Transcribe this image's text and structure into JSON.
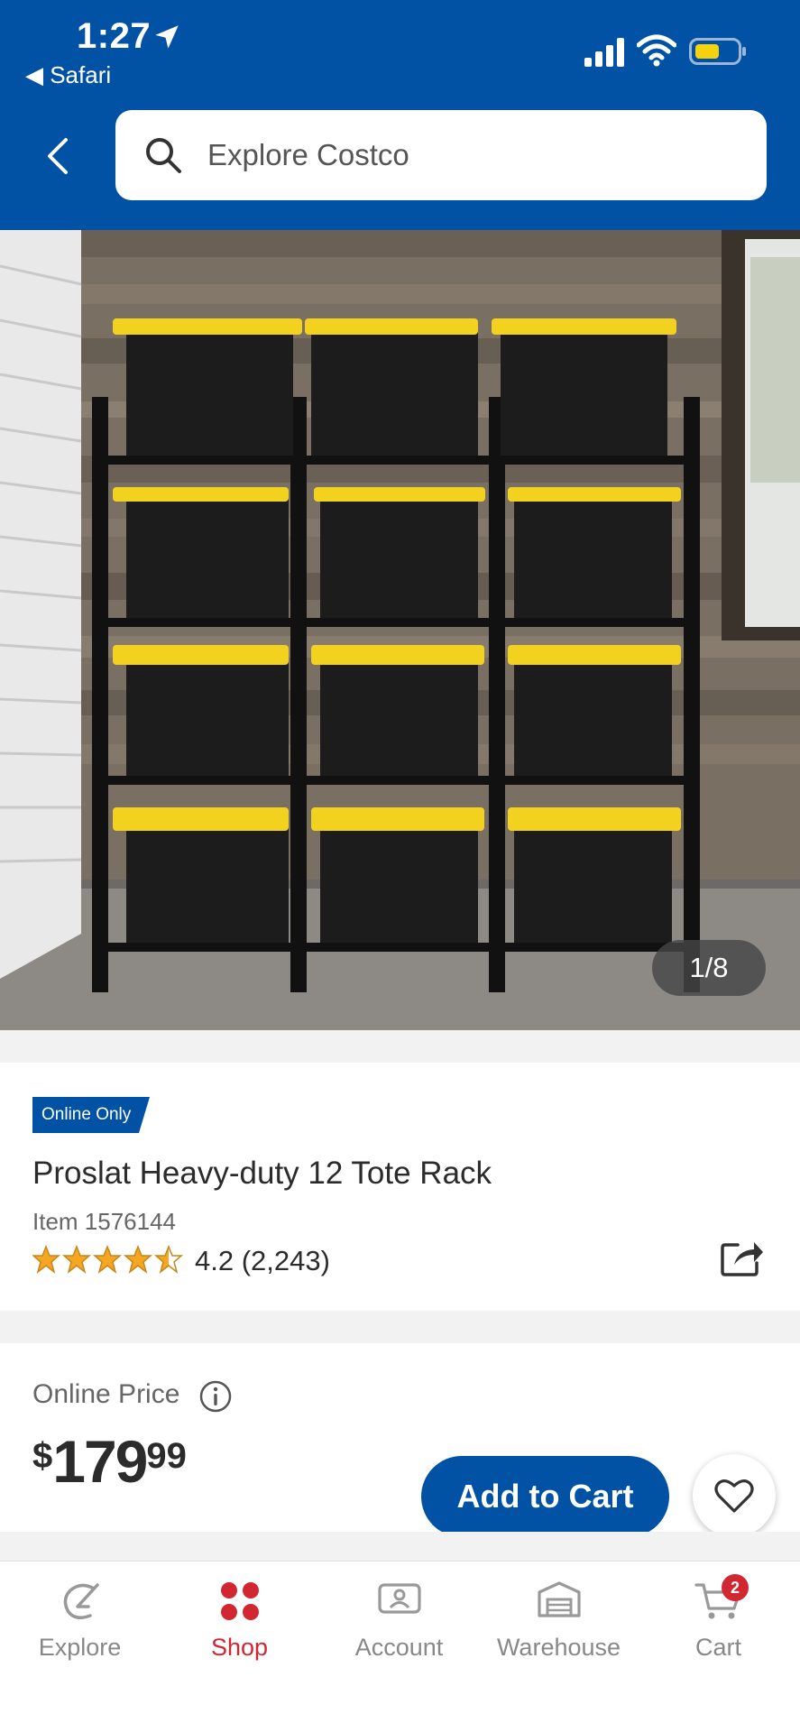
{
  "status_bar": {
    "time": "1:27",
    "back_app": "◀ Safari"
  },
  "search": {
    "placeholder": "Explore Costco"
  },
  "gallery": {
    "pager": "1/8"
  },
  "product": {
    "badge": "Online Only",
    "title": "Proslat Heavy-duty 12 Tote Rack",
    "item_number": "Item 1576144",
    "rating_text": "4.2 (2,243)",
    "rating_value": 4.2
  },
  "pricing": {
    "label": "Online Price",
    "currency": "$",
    "dollars": "179",
    "cents": "99"
  },
  "actions": {
    "add_to_cart": "Add to Cart"
  },
  "nav": {
    "items": [
      {
        "label": "Explore",
        "icon": "explore-icon"
      },
      {
        "label": "Shop",
        "icon": "shop-icon"
      },
      {
        "label": "Account",
        "icon": "account-icon"
      },
      {
        "label": "Warehouse",
        "icon": "warehouse-icon"
      },
      {
        "label": "Cart",
        "icon": "cart-icon"
      }
    ],
    "active": "Shop",
    "cart_count": "2"
  },
  "colors": {
    "brand_blue": "#0152a5",
    "accent_red": "#d22630",
    "star": "#f5a623",
    "tote_lid": "#f2d21e"
  }
}
